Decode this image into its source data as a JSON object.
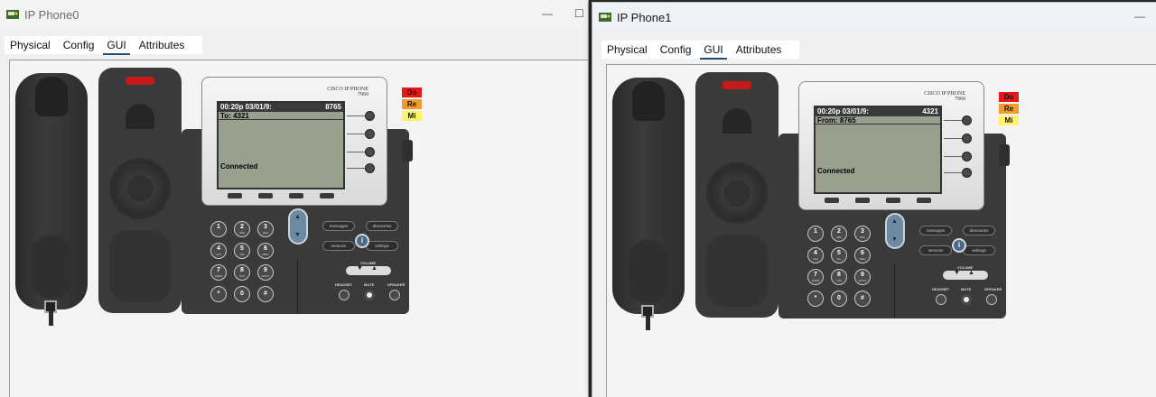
{
  "windows": [
    {
      "title": "IP Phone0",
      "tabs": [
        "Physical",
        "Config",
        "GUI",
        "Attributes"
      ],
      "active_tab": "GUI",
      "phone": {
        "brand_line1": "CISCO IP PHONE",
        "brand_line2": "7960",
        "lcd_time": "00:20p 03/01/9:",
        "lcd_ext": "8765",
        "lcd_line": "To: 4321",
        "lcd_status": "Connected",
        "status_tags": [
          {
            "label": "Do",
            "color": "#e8161b"
          },
          {
            "label": "Re",
            "color": "#f39a2c"
          },
          {
            "label": "Mi",
            "color": "#fff36a"
          }
        ]
      }
    },
    {
      "title": "IP Phone1",
      "tabs": [
        "Physical",
        "Config",
        "GUI",
        "Attributes"
      ],
      "active_tab": "GUI",
      "phone": {
        "brand_line1": "CISCO IP PHONE",
        "brand_line2": "7960",
        "lcd_time": "00:20p 03/01/9:",
        "lcd_ext": "4321",
        "lcd_line": "From: 8765",
        "lcd_status": "Connected",
        "status_tags": [
          {
            "label": "Do",
            "color": "#e8161b"
          },
          {
            "label": "Re",
            "color": "#f39a2c"
          },
          {
            "label": "Mi",
            "color": "#fff36a"
          }
        ]
      }
    }
  ],
  "window_controls": {
    "minimize": "—",
    "maximize": "☐"
  },
  "keypad": [
    {
      "d": "1",
      "s": ""
    },
    {
      "d": "2",
      "s": "ABC"
    },
    {
      "d": "3",
      "s": "DEF"
    },
    {
      "d": "4",
      "s": "GHI"
    },
    {
      "d": "5",
      "s": "JKL"
    },
    {
      "d": "6",
      "s": "MNO"
    },
    {
      "d": "7",
      "s": "PQRS"
    },
    {
      "d": "8",
      "s": "TUV"
    },
    {
      "d": "9",
      "s": "WXYZ"
    },
    {
      "d": "*",
      "s": ""
    },
    {
      "d": "0",
      "s": ""
    },
    {
      "d": "#",
      "s": ""
    }
  ],
  "function_buttons": {
    "messages": "messages",
    "directories": "directories",
    "services": "services",
    "settings": "settings",
    "info": "i"
  },
  "nav_arrows": {
    "up": "▲",
    "down": "▼"
  },
  "volume": {
    "label": "VOLUME",
    "down": "▼",
    "up": "▲"
  },
  "bottom_buttons": {
    "headset": "HEADSET",
    "mute": "MUTE",
    "speaker": "SPEAKER"
  }
}
